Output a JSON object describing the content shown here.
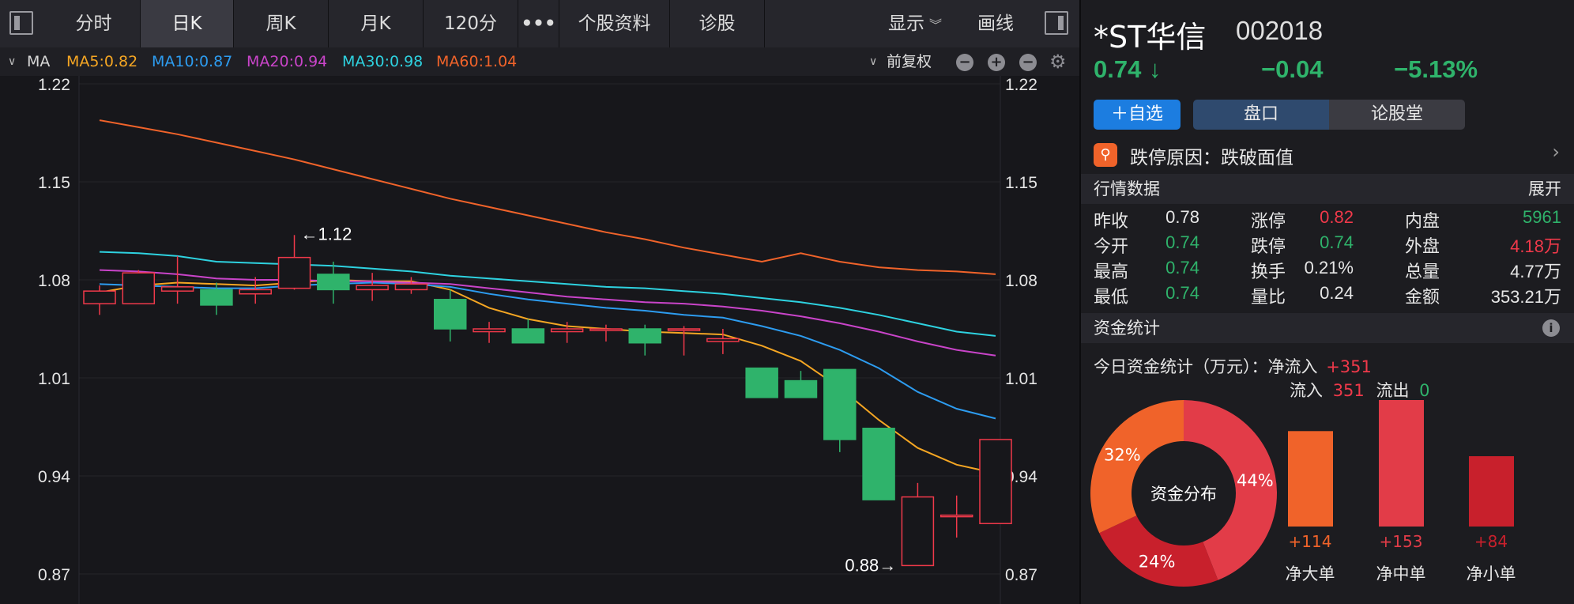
{
  "tabs": [
    "分时",
    "日K",
    "周K",
    "月K",
    "120分",
    "•••",
    "个股资料",
    "诊股"
  ],
  "active_tab": "日K",
  "toolbar": {
    "display_label": "显示",
    "draw_label": "画线"
  },
  "ma_bar": {
    "label": "MA",
    "items": [
      {
        "text": "MA5:0.82",
        "color": "#f5a623"
      },
      {
        "text": "MA10:0.87",
        "color": "#2d9cf0"
      },
      {
        "text": "MA20:0.94",
        "color": "#c944c9"
      },
      {
        "text": "MA30:0.98",
        "color": "#2ed2e0"
      },
      {
        "text": "MA60:1.04",
        "color": "#f0632a"
      }
    ],
    "adjust_label": "前复权"
  },
  "chart_data": {
    "type": "candlestick",
    "y_ticks": [
      "1.22",
      "1.15",
      "1.08",
      "1.01",
      "0.94",
      "0.87"
    ],
    "ylim": [
      0.87,
      1.22
    ],
    "annotations": {
      "high_label": "←1.12",
      "low_label": "0.88→"
    },
    "colors": {
      "up": "#f0394a",
      "down": "#2fb36b"
    },
    "candles": [
      {
        "open": 1.063,
        "close": 1.072,
        "high": 1.076,
        "low": 1.055
      },
      {
        "open": 1.063,
        "close": 1.085,
        "high": 1.087,
        "low": 1.063
      },
      {
        "open": 1.072,
        "close": 1.075,
        "high": 1.097,
        "low": 1.063
      },
      {
        "open": 1.073,
        "close": 1.062,
        "high": 1.078,
        "low": 1.055
      },
      {
        "open": 1.07,
        "close": 1.073,
        "high": 1.082,
        "low": 1.063
      },
      {
        "open": 1.074,
        "close": 1.096,
        "high": 1.112,
        "low": 1.073
      },
      {
        "open": 1.084,
        "close": 1.073,
        "high": 1.093,
        "low": 1.063
      },
      {
        "open": 1.073,
        "close": 1.076,
        "high": 1.085,
        "low": 1.065
      },
      {
        "open": 1.073,
        "close": 1.077,
        "high": 1.082,
        "low": 1.07
      },
      {
        "open": 1.066,
        "close": 1.045,
        "high": 1.073,
        "low": 1.036
      },
      {
        "open": 1.043,
        "close": 1.045,
        "high": 1.05,
        "low": 1.035
      },
      {
        "open": 1.045,
        "close": 1.035,
        "high": 1.052,
        "low": 1.035
      },
      {
        "open": 1.043,
        "close": 1.045,
        "high": 1.05,
        "low": 1.035
      },
      {
        "open": 1.044,
        "close": 1.045,
        "high": 1.048,
        "low": 1.036
      },
      {
        "open": 1.045,
        "close": 1.035,
        "high": 1.048,
        "low": 1.026
      },
      {
        "open": 1.044,
        "close": 1.045,
        "high": 1.047,
        "low": 1.026
      },
      {
        "open": 1.036,
        "close": 1.038,
        "high": 1.045,
        "low": 1.027
      },
      {
        "open": 1.017,
        "close": 0.996,
        "high": 1.017,
        "low": 0.996
      },
      {
        "open": 1.008,
        "close": 0.996,
        "high": 1.015,
        "low": 0.996
      },
      {
        "open": 1.016,
        "close": 0.966,
        "high": 1.016,
        "low": 0.957
      },
      {
        "open": 0.974,
        "close": 0.923,
        "high": 0.974,
        "low": 0.923
      },
      {
        "open": 0.876,
        "close": 0.925,
        "high": 0.935,
        "low": 0.876
      },
      {
        "open": 0.912,
        "close": 0.912,
        "high": 0.926,
        "low": 0.896
      },
      {
        "open": 0.906,
        "close": 0.966,
        "high": 0.966,
        "low": 0.906
      }
    ],
    "ma_series": [
      {
        "name": "MA5",
        "color": "#f5a623",
        "values": [
          1.071,
          1.076,
          1.078,
          1.077,
          1.076,
          1.078,
          1.08,
          1.079,
          1.079,
          1.073,
          1.06,
          1.052,
          1.047,
          1.045,
          1.043,
          1.042,
          1.041,
          1.033,
          1.022,
          1.003,
          0.98,
          0.96,
          0.948,
          0.942
        ]
      },
      {
        "name": "MA10",
        "color": "#2d9cf0",
        "values": [
          1.077,
          1.076,
          1.075,
          1.074,
          1.074,
          1.076,
          1.077,
          1.078,
          1.077,
          1.075,
          1.07,
          1.066,
          1.063,
          1.06,
          1.058,
          1.055,
          1.053,
          1.047,
          1.04,
          1.03,
          1.017,
          1.0,
          0.988,
          0.981
        ]
      },
      {
        "name": "MA20",
        "color": "#c944c9",
        "values": [
          1.087,
          1.086,
          1.084,
          1.081,
          1.08,
          1.08,
          1.079,
          1.079,
          1.078,
          1.077,
          1.074,
          1.071,
          1.068,
          1.066,
          1.064,
          1.063,
          1.061,
          1.058,
          1.054,
          1.049,
          1.043,
          1.036,
          1.03,
          1.026
        ]
      },
      {
        "name": "MA30",
        "color": "#2ed2e0",
        "values": [
          1.1,
          1.099,
          1.097,
          1.093,
          1.092,
          1.091,
          1.09,
          1.088,
          1.086,
          1.083,
          1.081,
          1.079,
          1.077,
          1.075,
          1.074,
          1.072,
          1.07,
          1.067,
          1.064,
          1.06,
          1.055,
          1.049,
          1.043,
          1.04
        ]
      },
      {
        "name": "MA60",
        "color": "#f0632a",
        "values": [
          1.194,
          1.189,
          1.184,
          1.178,
          1.172,
          1.166,
          1.159,
          1.152,
          1.145,
          1.138,
          1.132,
          1.126,
          1.12,
          1.114,
          1.109,
          1.103,
          1.098,
          1.093,
          1.099,
          1.093,
          1.089,
          1.087,
          1.086,
          1.084
        ]
      }
    ]
  },
  "stock": {
    "name": "*ST华信",
    "code": "002018",
    "price": "0.74",
    "arrow": "↓",
    "change": "−0.04",
    "change_pct": "−5.13%"
  },
  "actions": {
    "add_fav": "＋自选",
    "pankou": "盘口",
    "forum": "论股堂"
  },
  "limit_reason": {
    "icon": "⚲",
    "text": "跌停原因：跌破面值",
    "chevron": "›"
  },
  "quotes": {
    "title": "行情数据",
    "expand": "展开",
    "rows": [
      [
        {
          "l": "昨收",
          "v": "0.78",
          "c": "wh"
        },
        {
          "l": "涨停",
          "v": "0.82",
          "c": "rd"
        },
        {
          "l": "内盘",
          "v": "5961",
          "c": "gr"
        }
      ],
      [
        {
          "l": "今开",
          "v": "0.74",
          "c": "gr"
        },
        {
          "l": "跌停",
          "v": "0.74",
          "c": "gr"
        },
        {
          "l": "外盘",
          "v": "4.18万",
          "c": "rd"
        }
      ],
      [
        {
          "l": "最高",
          "v": "0.74",
          "c": "gr"
        },
        {
          "l": "换手",
          "v": "0.21%",
          "c": "wh"
        },
        {
          "l": "总量",
          "v": "4.77万",
          "c": "wh"
        }
      ],
      [
        {
          "l": "最低",
          "v": "0.74",
          "c": "gr"
        },
        {
          "l": "量比",
          "v": "0.24",
          "c": "wh"
        },
        {
          "l": "金额",
          "v": "353.21万",
          "c": "wh"
        }
      ]
    ]
  },
  "fund": {
    "title": "资金统计",
    "info_icon": "i",
    "line1_label": "今日资金统计（万元）：净流入",
    "line1_value": "+351",
    "in_label": "流入",
    "in_value": "351",
    "out_label": "流出",
    "out_value": "0",
    "donut_center": "资金分布",
    "donut": [
      {
        "pct": 44,
        "label": "44%",
        "color": "#e23c48"
      },
      {
        "pct": 24,
        "label": "24%",
        "color": "#c8202c"
      },
      {
        "pct": 32,
        "label": "32%",
        "color": "#f0632a"
      }
    ],
    "bars": [
      {
        "name": "净大单",
        "value": 114,
        "label": "+114",
        "color": "#f0632a"
      },
      {
        "name": "净中单",
        "value": 153,
        "label": "+153",
        "color": "#e23c48"
      },
      {
        "name": "净小单",
        "value": 84,
        "label": "+84",
        "color": "#c8202c"
      }
    ]
  }
}
